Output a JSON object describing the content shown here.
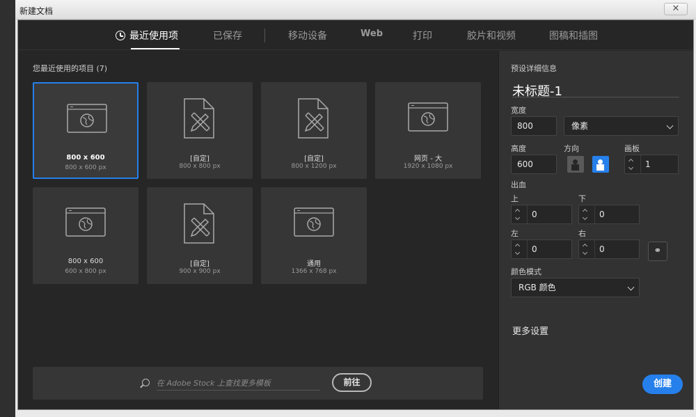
{
  "window": {
    "title": "新建文档",
    "close_glyph": "✕"
  },
  "tabs": [
    {
      "label": "最近使用项",
      "active": true
    },
    {
      "label": "已保存"
    },
    {
      "label": "移动设备"
    },
    {
      "label": "Web"
    },
    {
      "label": "打印"
    },
    {
      "label": "胶片和视频"
    },
    {
      "label": "图稿和插图"
    }
  ],
  "recent": {
    "heading": "您最近使用的项目",
    "count": "(7)",
    "items": [
      {
        "name": "800 x 600",
        "dims": "800 x 600 px",
        "icon": "web-icon",
        "selected": true
      },
      {
        "name": "[自定]",
        "dims": "800 x 800 px",
        "icon": "document-pencil-icon"
      },
      {
        "name": "[自定]",
        "dims": "800 x 1200 px",
        "icon": "document-pencil-icon"
      },
      {
        "name": "网页 - 大",
        "dims": "1920 x 1080 px",
        "icon": "web-icon"
      },
      {
        "name": "800 x 600",
        "dims": "600 x 800 px",
        "icon": "web-icon"
      },
      {
        "name": "[自定]",
        "dims": "900 x 900 px",
        "icon": "document-pencil-icon"
      },
      {
        "name": "通用",
        "dims": "1366 x 768 px",
        "icon": "web-icon"
      }
    ]
  },
  "stock_search": {
    "placeholder": "在 Adobe Stock 上查找更多模板",
    "button": "前往"
  },
  "preset": {
    "heading": "预设详细信息",
    "doc_name": "未标题-1",
    "width_label": "宽度",
    "width_value": "800",
    "unit": "像素",
    "height_label": "高度",
    "height_value": "600",
    "orientation_label": "方向",
    "orientation_selected": "landscape",
    "artboard_label": "画板",
    "artboard_value": "1",
    "bleed_label": "出血",
    "bleed_top_label": "上",
    "bleed_top": "0",
    "bleed_bottom_label": "下",
    "bleed_bottom": "0",
    "bleed_left_label": "左",
    "bleed_left": "0",
    "bleed_right_label": "右",
    "bleed_right": "0",
    "color_mode_label": "颜色模式",
    "color_mode": "RGB 颜色",
    "more_settings": "更多设置",
    "create_button": "创建"
  },
  "colors": {
    "accent": "#2680eb",
    "panel_bg": "#262626",
    "card_bg": "#363636"
  }
}
